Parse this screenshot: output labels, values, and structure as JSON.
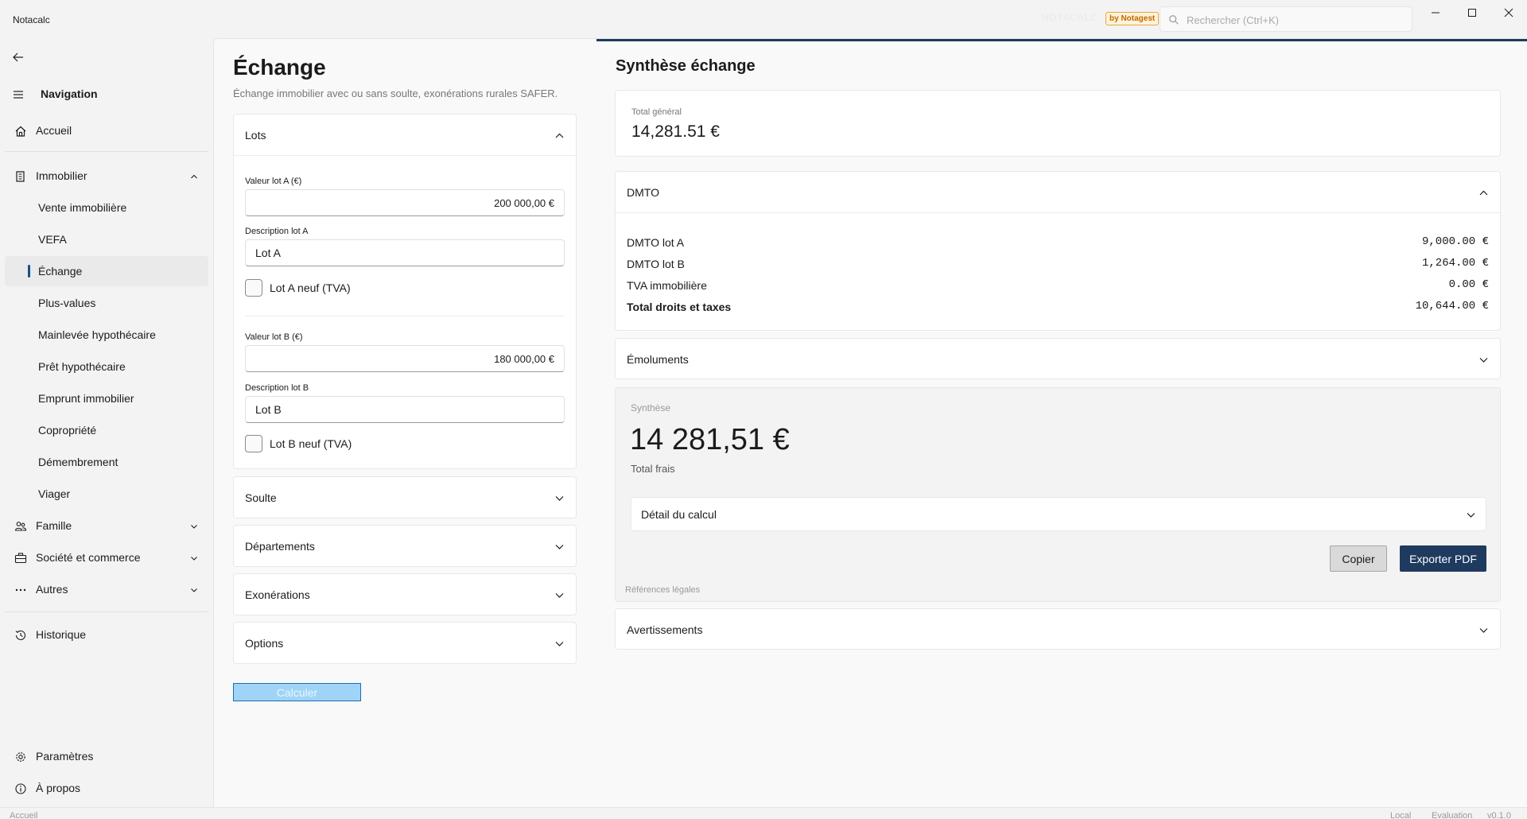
{
  "window": {
    "title": "Notacalc",
    "brand": "NOTACALC",
    "brand_badge": "by Notagest",
    "search_placeholder": "Rechercher (Ctrl+K)"
  },
  "sidebar": {
    "nav_title": "Navigation",
    "items": [
      {
        "label": "Accueil",
        "icon": "home-icon"
      },
      {
        "label": "Immobilier",
        "icon": "building-icon",
        "expanded": true
      },
      {
        "label": "Vente immobilière"
      },
      {
        "label": "VEFA"
      },
      {
        "label": "Échange",
        "active": true
      },
      {
        "label": "Plus-values"
      },
      {
        "label": "Mainlevée hypothécaire"
      },
      {
        "label": "Prêt hypothécaire"
      },
      {
        "label": "Emprunt immobilier"
      },
      {
        "label": "Copropriété"
      },
      {
        "label": "Démembrement"
      },
      {
        "label": "Viager"
      },
      {
        "label": "Famille",
        "icon": "people-icon"
      },
      {
        "label": "Société et commerce",
        "icon": "briefcase-icon"
      },
      {
        "label": "Autres",
        "icon": "more-icon"
      },
      {
        "label": "Historique",
        "icon": "history-icon"
      },
      {
        "label": "Paramètres",
        "icon": "gear-icon"
      },
      {
        "label": "À propos",
        "icon": "info-icon"
      }
    ]
  },
  "page": {
    "title": "Échange",
    "subtitle": "Échange immobilier avec ou sans soulte, exonérations rurales SAFER."
  },
  "lots": {
    "header": "Lots",
    "valeur_a_label": "Valeur lot A (€)",
    "valeur_a": "200 000,00 €",
    "desc_a_label": "Description lot A",
    "desc_a": "Lot A",
    "neuf_a_label": "Lot A neuf (TVA)",
    "valeur_b_label": "Valeur lot B (€)",
    "valeur_b": "180 000,00 €",
    "desc_b_label": "Description lot B",
    "desc_b": "Lot B",
    "neuf_b_label": "Lot B neuf (TVA)"
  },
  "sections": {
    "soulte": "Soulte",
    "departements": "Départements",
    "exonerations": "Exonérations",
    "options": "Options"
  },
  "calculate_label": "Calculer",
  "synthese": {
    "title": "Synthèse échange",
    "total_label": "Total général",
    "total_value": "14,281.51 €",
    "dmto": {
      "header": "DMTO",
      "rows": [
        {
          "label": "DMTO lot A",
          "value": "9,000.00 €"
        },
        {
          "label": "DMTO lot B",
          "value": "1,264.00 €"
        },
        {
          "label": "TVA immobilière",
          "value": "0.00 €"
        },
        {
          "label": "Total droits et taxes",
          "value": "10,644.00 €"
        }
      ]
    },
    "emoluments": "Émoluments",
    "card_label": "Synthèse",
    "card_value": "14 281,51 €",
    "card_sub": "Total frais",
    "detail_label": "Détail du calcul",
    "copy_label": "Copier",
    "export_label": "Exporter PDF",
    "refs_label": "Références légales",
    "avertissements": "Avertissements"
  },
  "statusbar": {
    "left": "Accueil",
    "mode": "Local",
    "license": "Evaluation",
    "version": "v0.1.0"
  },
  "colors": {
    "accent": "#1e3a5f",
    "active_indicator": "#1a4f8a",
    "calc_button": "#9fd4f7"
  }
}
